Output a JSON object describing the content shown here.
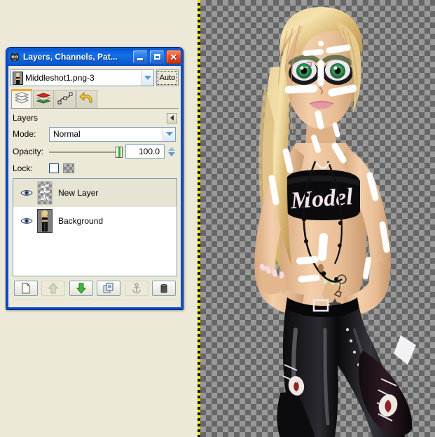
{
  "window": {
    "title": "Layers, Channels, Pat...",
    "icon": "gimp-wilber-icon",
    "buttons": {
      "minimize": "Minimize",
      "maximize": "Maximize",
      "close": "Close"
    }
  },
  "image_selector": {
    "value": "Middleshot1.png-3",
    "thumbnail": "image-thumbnail",
    "dropdown_icon": "chevron-down-icon",
    "auto_label": "Auto"
  },
  "tabs": [
    {
      "name": "layers",
      "label": "Layers",
      "icon": "layers-stack-icon",
      "active": true
    },
    {
      "name": "channels",
      "label": "Channels",
      "icon": "channels-books-icon",
      "active": false
    },
    {
      "name": "paths",
      "label": "Paths",
      "icon": "paths-node-icon",
      "active": false
    },
    {
      "name": "undo-history",
      "label": "Undo History",
      "icon": "undo-arrow-icon",
      "active": false
    }
  ],
  "panel": {
    "title": "Layers",
    "menu_icon": "triangle-left-icon"
  },
  "controls": {
    "mode_label": "Mode:",
    "mode_value": "Normal",
    "opacity_label": "Opacity:",
    "opacity_value": "100.0",
    "opacity_percent": 100,
    "lock_label": "Lock:",
    "lock_pixels_checked": false,
    "lock_alpha_icon": "checkerboard-alpha-icon"
  },
  "layers": [
    {
      "name": "New Layer",
      "visible": true,
      "selected": true,
      "thumbnail": "transparent-with-white-strokes",
      "visibility_icon": "eye-icon"
    },
    {
      "name": "Background",
      "visible": true,
      "selected": false,
      "thumbnail": "avatar-thumbnail",
      "visibility_icon": "eye-icon"
    }
  ],
  "layer_toolbar": [
    {
      "name": "new-layer",
      "label": "New Layer",
      "icon": "new-page-icon",
      "enabled": true
    },
    {
      "name": "raise-layer",
      "label": "Raise Layer",
      "icon": "up-arrow-icon",
      "enabled": false
    },
    {
      "name": "lower-layer",
      "label": "Lower Layer",
      "icon": "down-arrow-icon",
      "enabled": true
    },
    {
      "name": "duplicate-layer",
      "label": "Duplicate Layer",
      "icon": "duplicate-icon",
      "enabled": true
    },
    {
      "name": "anchor-layer",
      "label": "Anchor Layer",
      "icon": "anchor-icon",
      "enabled": false
    },
    {
      "name": "delete-layer",
      "label": "Delete Layer",
      "icon": "trash-icon",
      "enabled": true
    }
  ],
  "canvas": {
    "transparency_checker": {
      "dark": "#666666",
      "light": "#999999",
      "square_size": 8
    },
    "selection_border": {
      "colors": [
        "#f2e400",
        "#141414"
      ],
      "style": "marching-ants-dashed"
    },
    "artwork": {
      "subject": "stylized-female-avatar",
      "top_text": "Model",
      "annotations": "white-paint-strokes"
    }
  },
  "theme": {
    "desktop_background": "#ece9d8",
    "title_bar_blue": "#0b55d4",
    "close_button_red": "#e8522c",
    "accent_tab_orange": "#f0a830",
    "selection_row": "#e7e4d4"
  }
}
